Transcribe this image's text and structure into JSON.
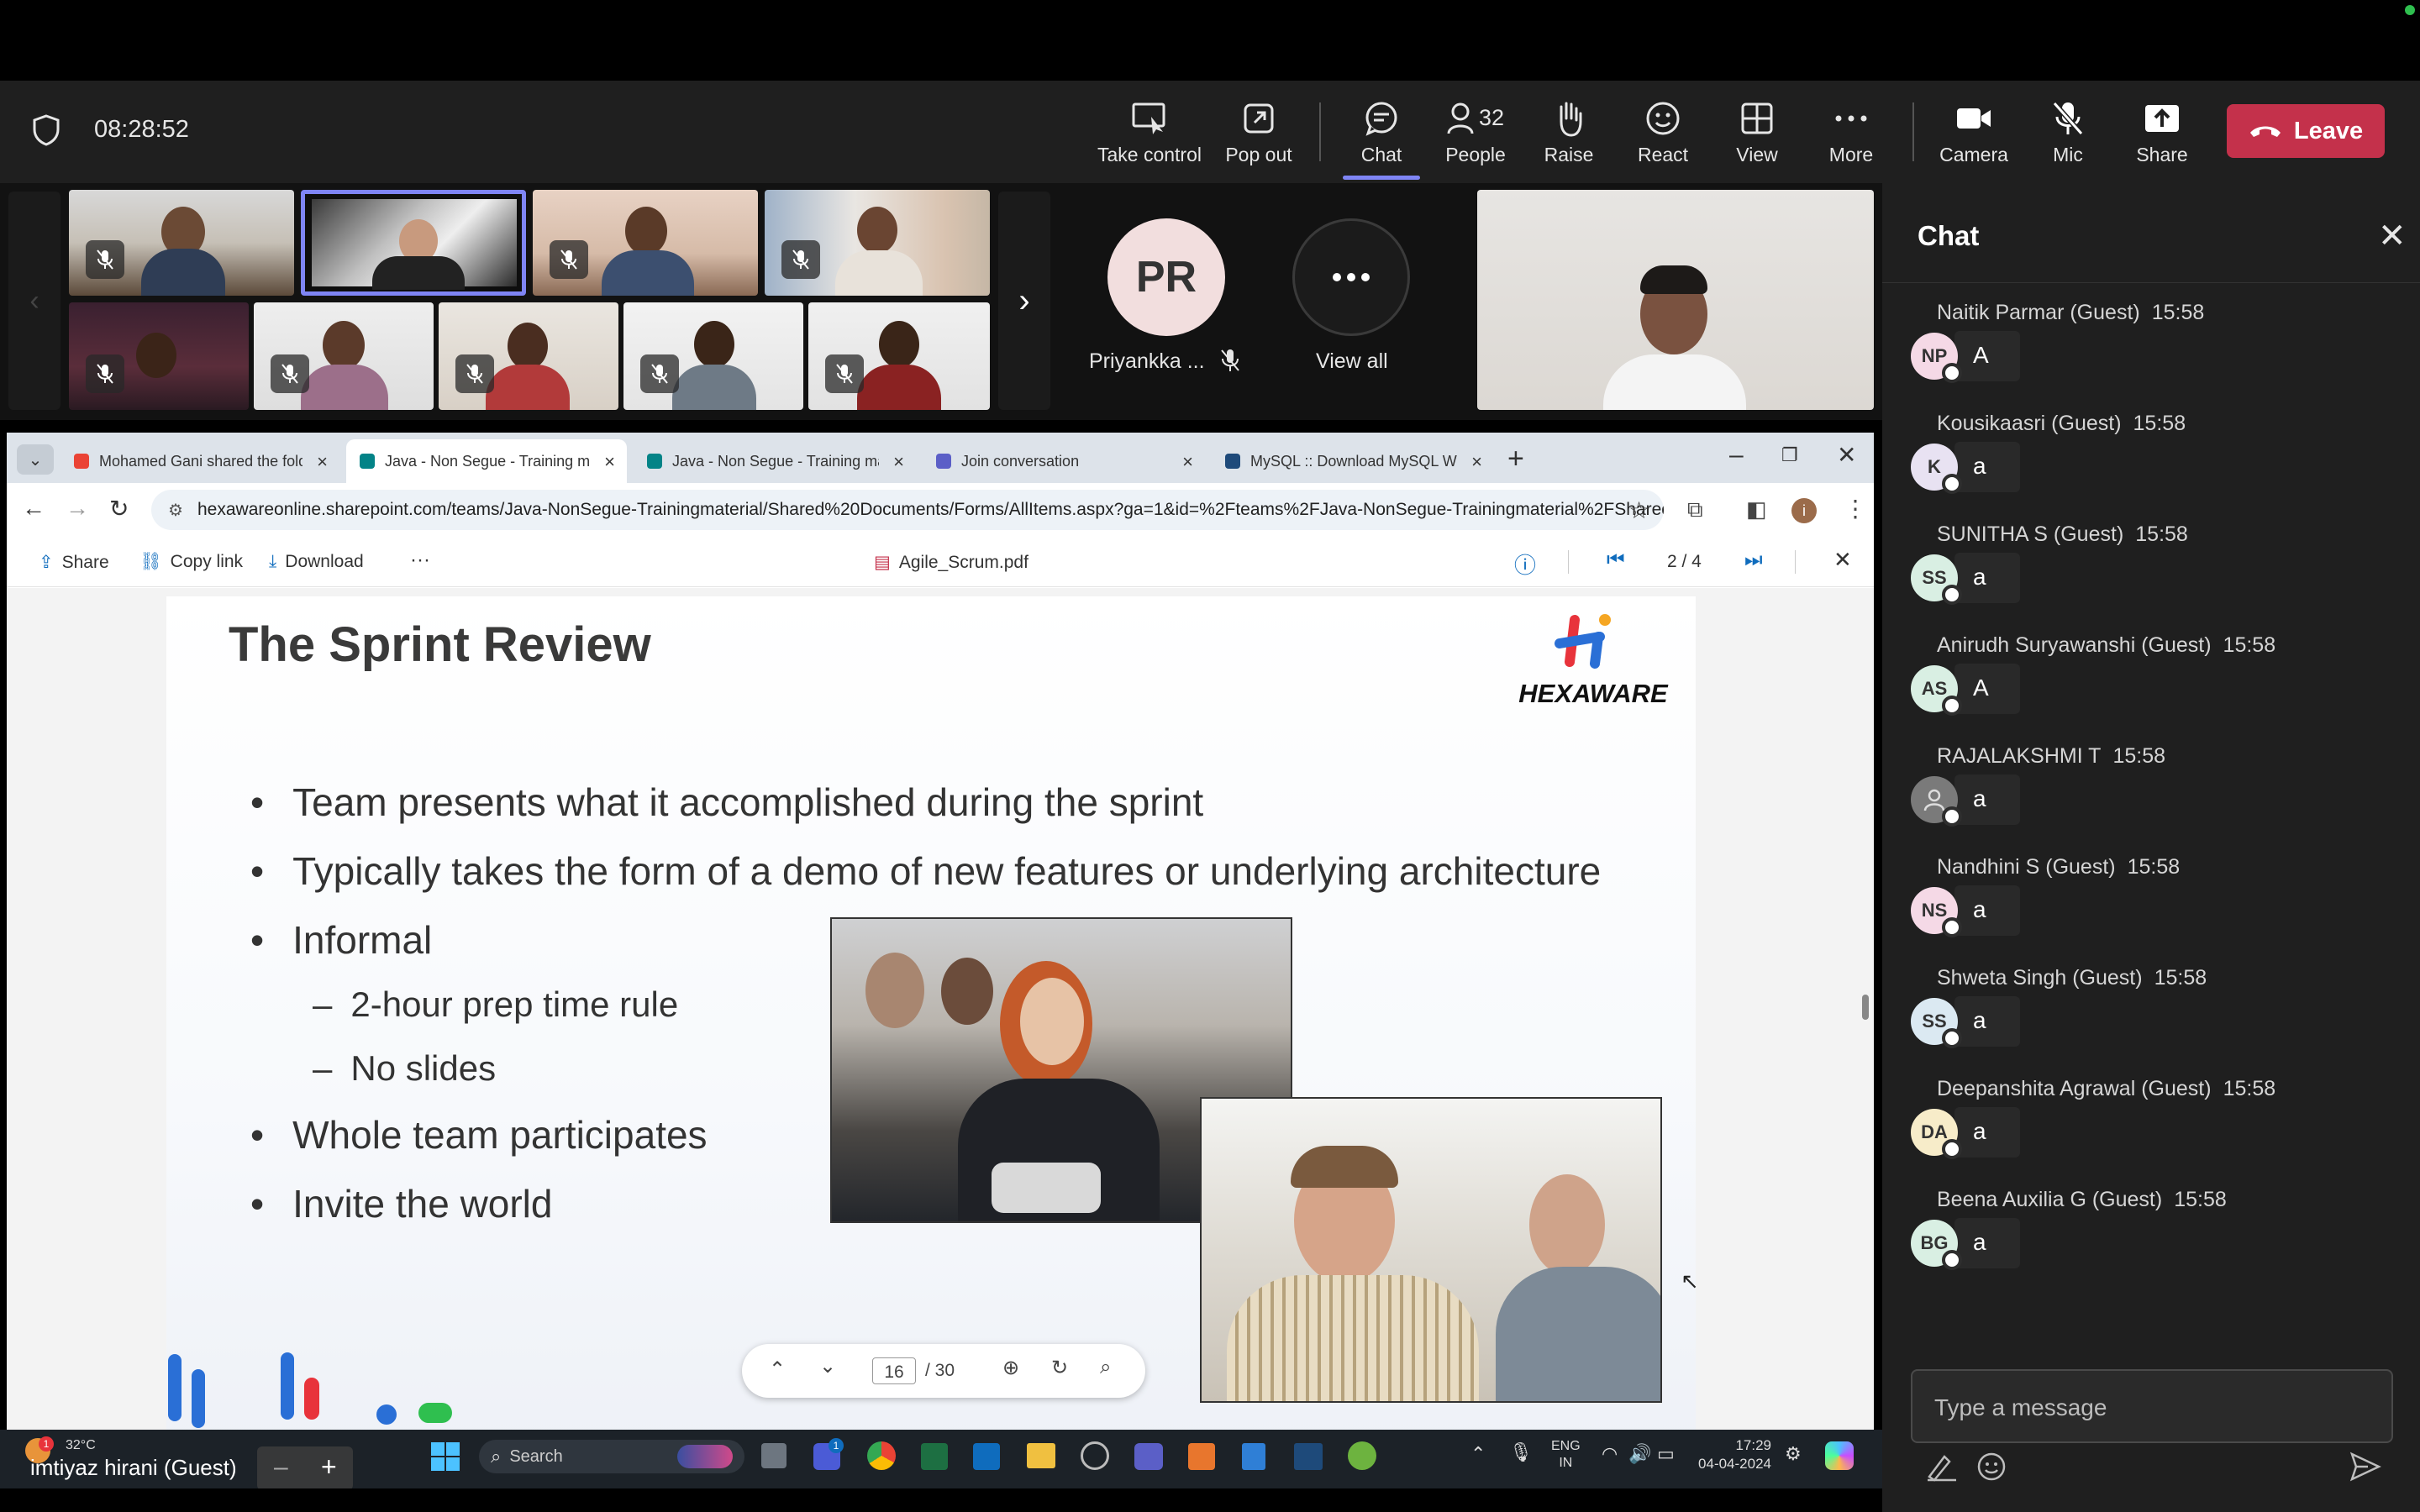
{
  "meeting": {
    "timer": "08:28:52",
    "toolbar": {
      "take_control": "Take control",
      "pop_out": "Pop out",
      "chat": "Chat",
      "people": "People",
      "people_count": "32",
      "raise": "Raise",
      "react": "React",
      "view": "View",
      "more": "More",
      "camera": "Camera",
      "mic": "Mic",
      "share": "Share",
      "leave": "Leave"
    },
    "participant_initials": "PR",
    "participant_name": "Priyankka ...",
    "view_all": "View all",
    "self_name": "imtiyaz hirani (Guest)"
  },
  "chat": {
    "title": "Chat",
    "input_placeholder": "Type a message",
    "messages": [
      {
        "name": "Naitik Parmar (Guest)",
        "time": "15:58",
        "initials": "NP",
        "text": "A",
        "color": "#f5d9e6"
      },
      {
        "name": "Kousikaasri (Guest)",
        "time": "15:58",
        "initials": "K",
        "text": "a",
        "color": "#e8e2f2"
      },
      {
        "name": "SUNITHA S (Guest)",
        "time": "15:58",
        "initials": "SS",
        "text": "a",
        "color": "#d9efe3"
      },
      {
        "name": "Anirudh Suryawanshi (Guest)",
        "time": "15:58",
        "initials": "AS",
        "text": "A",
        "color": "#d9efe3"
      },
      {
        "name": "RAJALAKSHMI T",
        "time": "15:58",
        "initials": "",
        "text": "a",
        "color": "#7a7a7a"
      },
      {
        "name": "Nandhini S (Guest)",
        "time": "15:58",
        "initials": "NS",
        "text": "a",
        "color": "#f5d9e6"
      },
      {
        "name": "Shweta Singh (Guest)",
        "time": "15:58",
        "initials": "SS",
        "text": "a",
        "color": "#dbe9f2"
      },
      {
        "name": "Deepanshita Agrawal (Guest)",
        "time": "15:58",
        "initials": "DA",
        "text": "a",
        "color": "#f7ecc9"
      },
      {
        "name": "Beena Auxilia G (Guest)",
        "time": "15:58",
        "initials": "BG",
        "text": "a",
        "color": "#d9efe3"
      }
    ]
  },
  "browser": {
    "tabs": [
      {
        "label": "Mohamed Gani shared the fold",
        "icon": "gmail-icon"
      },
      {
        "label": "Java - Non Segue - Training ma",
        "icon": "sharepoint-icon"
      },
      {
        "label": "Java - Non Segue - Training ma",
        "icon": "sharepoint-icon"
      },
      {
        "label": "Join conversation",
        "icon": "teams-icon"
      },
      {
        "label": "MySQL :: Download MySQL Wo",
        "icon": "mysql-icon"
      }
    ],
    "url": "hexawareonline.sharepoint.com/teams/Java-NonSegue-Trainingmaterial/Shared%20Documents/Forms/AllItems.aspx?ga=1&id=%2Fteams%2FJava-NonSegue-Trainingmaterial%2FShared...",
    "profile_initial": "i"
  },
  "pdf": {
    "share": "Share",
    "copy_link": "Copy link",
    "download": "Download",
    "more": "···",
    "filename": "Agile_Scrum.pdf",
    "page_indicator": "2 / 4",
    "current_page": "16",
    "total_pages": "/ 30"
  },
  "slide": {
    "title": "The Sprint Review",
    "brand": "HEXAWARE",
    "bullets": [
      "Team presents what it accomplished during the sprint",
      "Typically takes the form of a demo of new features or underlying architecture",
      "Informal",
      "Whole team participates",
      "Invite the world"
    ],
    "sub_bullets": [
      "2-hour prep time rule",
      "No slides"
    ]
  },
  "taskbar": {
    "weather_temp": "32°C",
    "weather_badge": "1",
    "search": "Search",
    "lang1": "ENG",
    "lang2": "IN",
    "time": "17:29",
    "date": "04-04-2024",
    "teams_badge": "1"
  }
}
